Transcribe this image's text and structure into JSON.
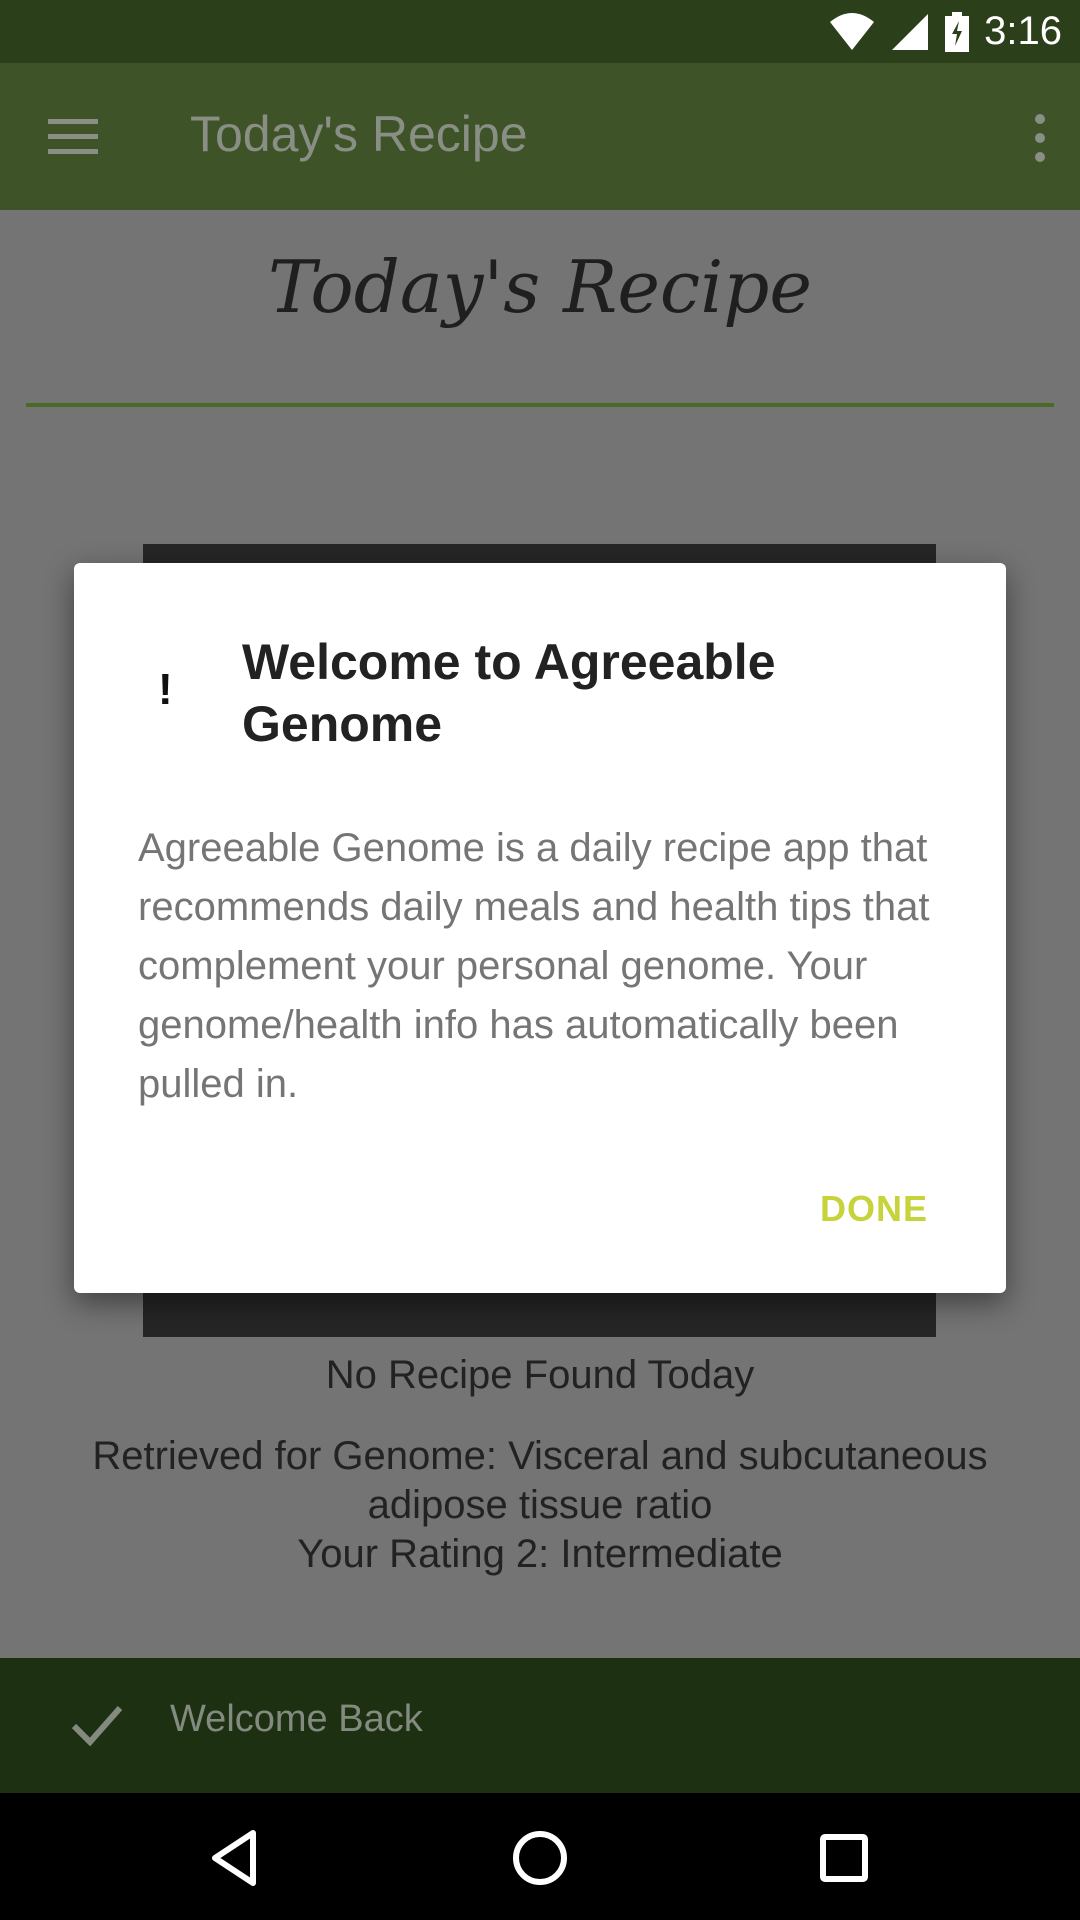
{
  "status_bar": {
    "time": "3:16",
    "icons": [
      "wifi-icon",
      "signal-icon",
      "battery-charging-icon"
    ]
  },
  "toolbar": {
    "title": "Today's Recipe",
    "menu_icon": "menu-icon",
    "overflow_icon": "more-vert-icon"
  },
  "content": {
    "script_title": "Today's Recipe",
    "no_recipe_text": "No Recipe Found Today",
    "genome_lines": [
      "Retrieved for Genome: Visceral and subcutaneous",
      "adipose tissue ratio",
      "Your Rating 2: Intermediate"
    ]
  },
  "dialog": {
    "icon_text": "!",
    "title": "Welcome to Agreeable Genome",
    "message": "Agreeable Genome is a daily recipe app that recommends daily meals and health tips that complement your personal genome. Your genome/health info has automatically been pulled in.",
    "done_label": "DONE"
  },
  "snackbar": {
    "text": "Welcome Back",
    "icon": "check-icon"
  },
  "nav_bar": {
    "buttons": [
      "back-icon",
      "home-icon",
      "recents-icon"
    ]
  },
  "colors": {
    "status_bar": "#2c3f1b",
    "toolbar": "#3f5328",
    "scrim_content": "#747474",
    "accent": "#c6d33a",
    "snackbar": "#1d3012"
  }
}
